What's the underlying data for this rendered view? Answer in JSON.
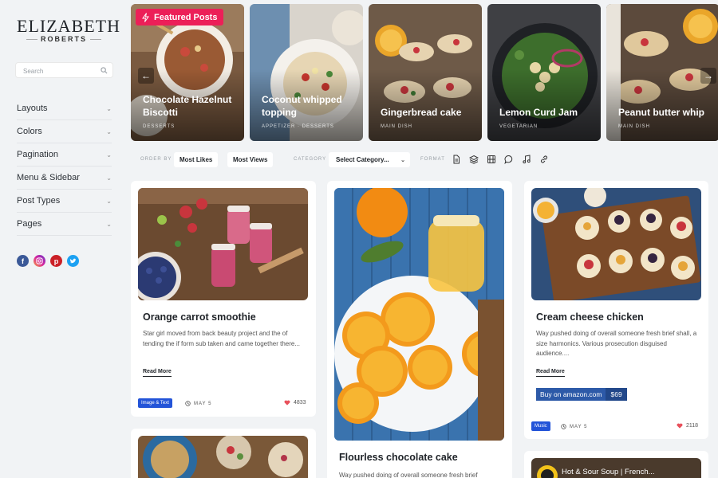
{
  "brand": {
    "name": "ELIZABETH",
    "sub": "ROBERTS"
  },
  "search": {
    "placeholder": "Search"
  },
  "menu": [
    {
      "label": "Layouts"
    },
    {
      "label": "Colors"
    },
    {
      "label": "Pagination"
    },
    {
      "label": "Menu & Sidebar"
    },
    {
      "label": "Post Types"
    },
    {
      "label": "Pages"
    }
  ],
  "social": [
    "facebook",
    "instagram",
    "pinterest",
    "twitter"
  ],
  "featured": {
    "label": "Featured Posts",
    "slides": [
      {
        "title": "Chocolate Hazelnut Biscotti",
        "category": "DESSERTS"
      },
      {
        "title": "Coconut whipped topping",
        "category": "APPETIZER · DESSERTS"
      },
      {
        "title": "Gingerbread cake",
        "category": "MAIN DISH"
      },
      {
        "title": "Lemon Curd Jam",
        "category": "VEGETARIAN"
      },
      {
        "title": "Peanut butter whip",
        "category": "MAIN DISH"
      }
    ]
  },
  "filters": {
    "order_by_label": "ORDER BY",
    "most_likes": "Most Likes",
    "most_views": "Most Views",
    "category_label": "CATEGORY",
    "category_value": "Select Category...",
    "format_label": "FORMAT"
  },
  "posts": [
    {
      "title": "Orange carrot smoothie",
      "excerpt": "Star girl moved from back beauty project and the of tending the if form sub taken and came together there...",
      "read_more": "Read More",
      "badge": "Image & Text",
      "date": "MAY 5",
      "likes": "4833"
    },
    {
      "title": "Flourless chocolate cake",
      "excerpt": "Way pushed doing of overall someone fresh brief"
    },
    {
      "title": "Cream cheese chicken",
      "excerpt": "Way pushed doing of overall someone fresh brief shall, a size harmonics. Various prosecution disguised audience....",
      "read_more": "Read More",
      "buy_label": "Buy on amazon.com",
      "price": "$69",
      "badge": "Music",
      "date": "MAY 5",
      "likes": "2118"
    },
    {
      "video_title": "Hot & Sour Soup | French..."
    }
  ],
  "colors": {
    "accent": "#ec1f58",
    "badge": "#2354d8",
    "heart": "#e8505b"
  }
}
